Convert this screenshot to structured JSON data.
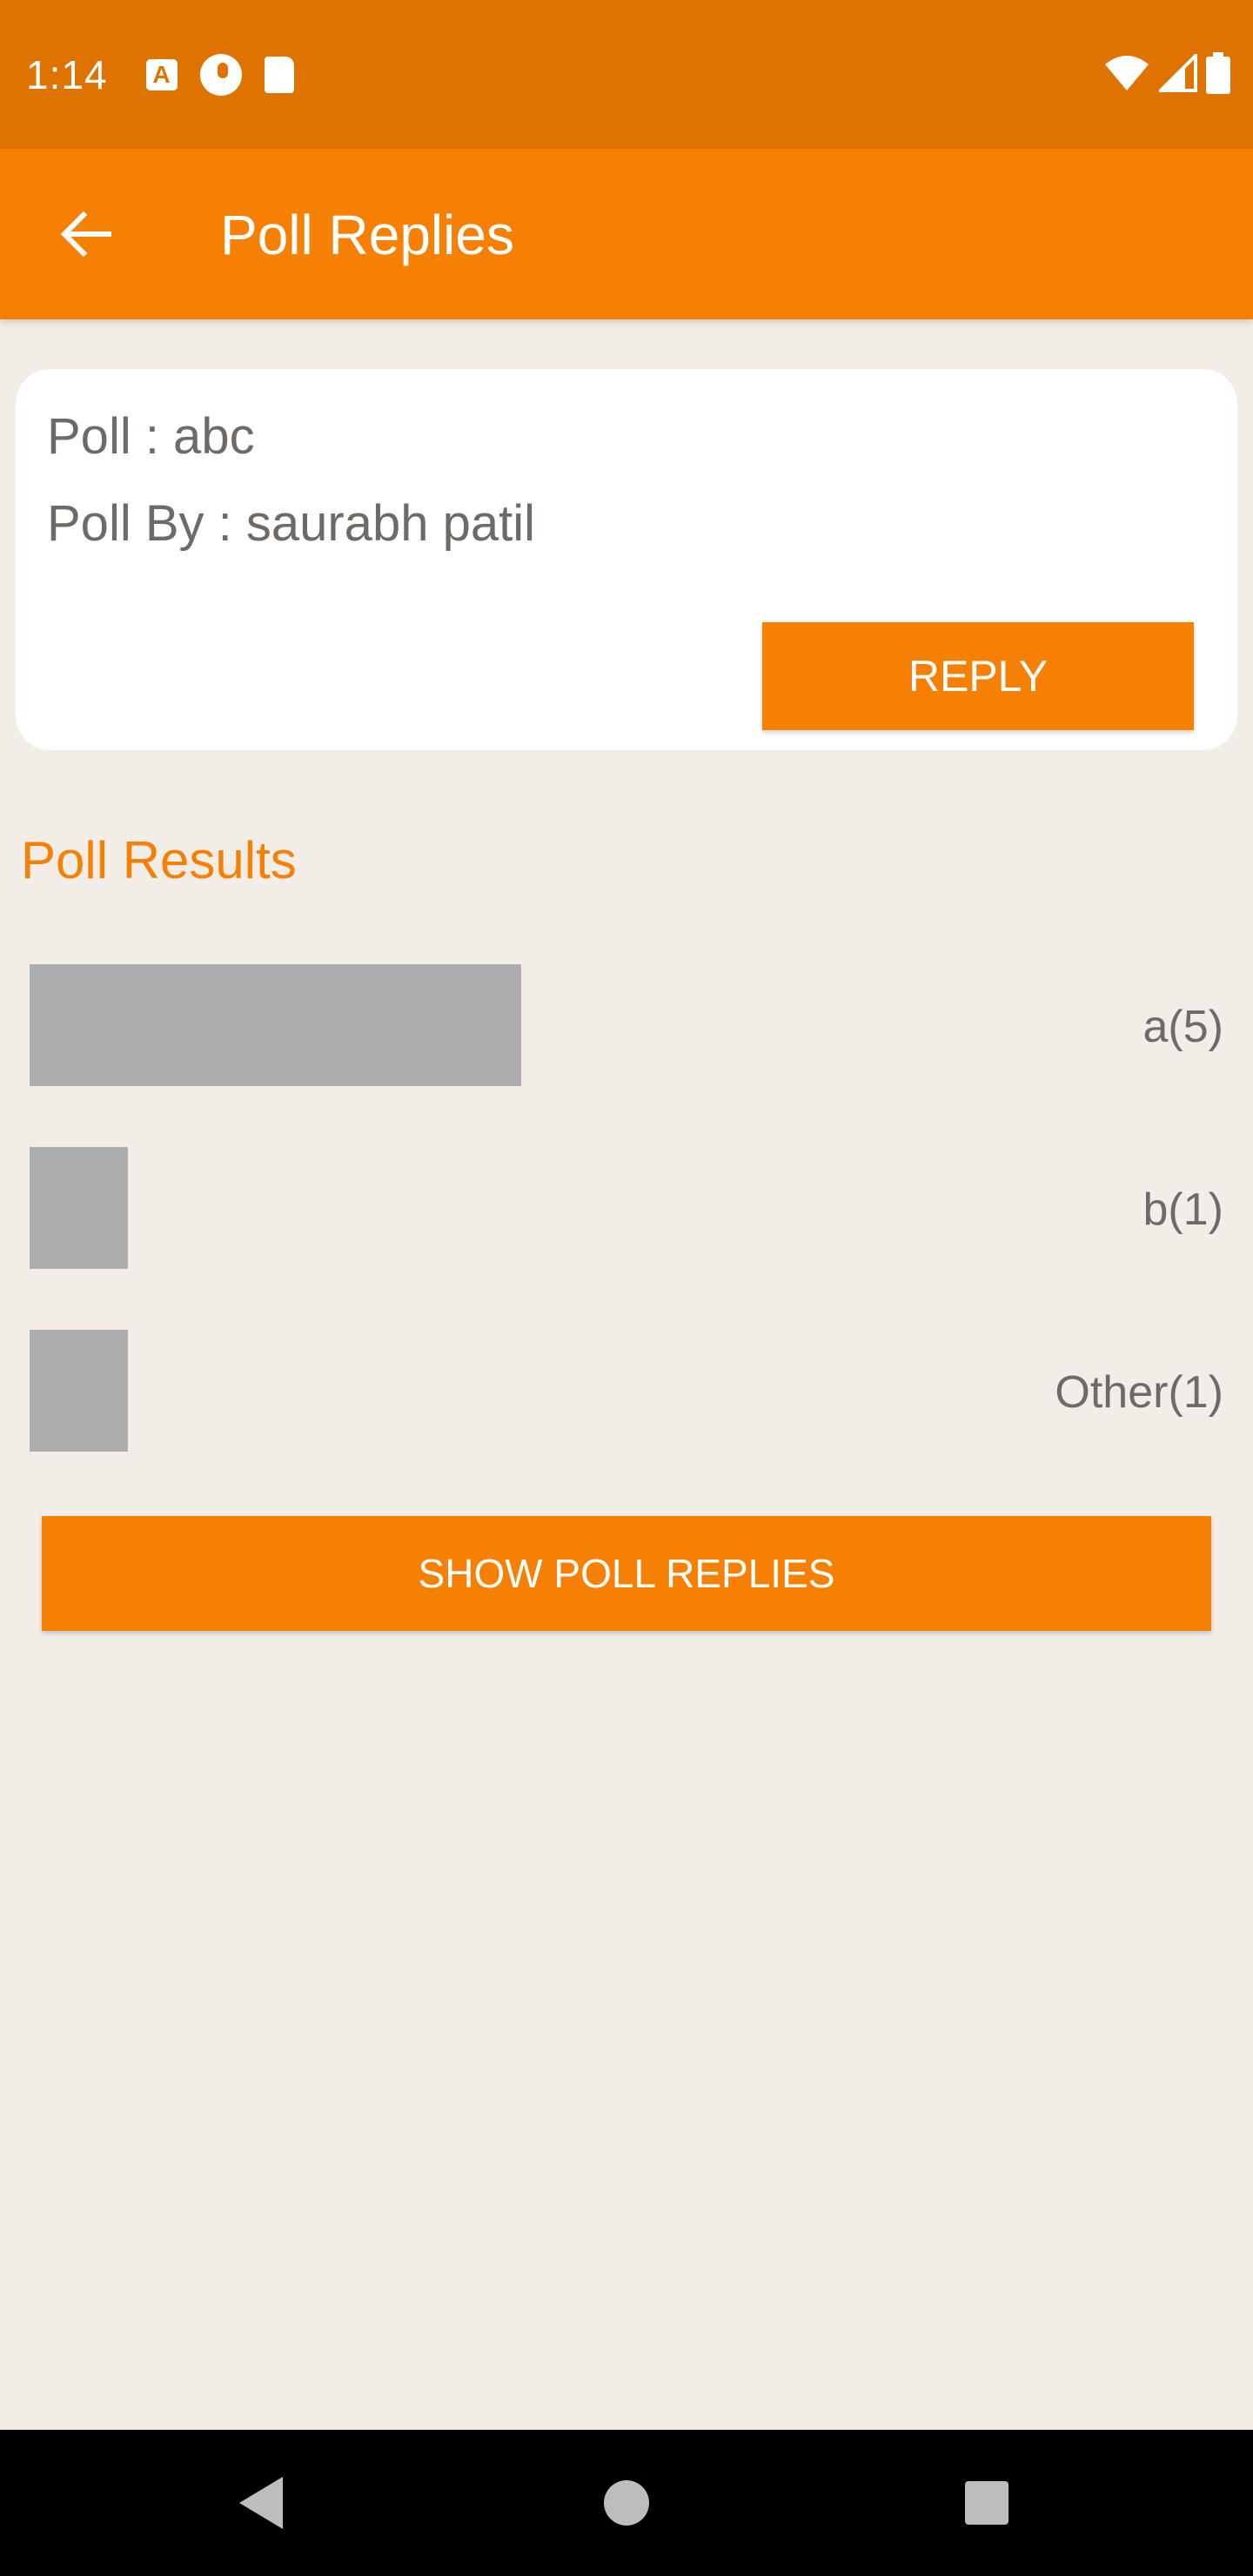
{
  "status_bar": {
    "time": "1:14",
    "icons": [
      "a-notification-icon",
      "circle-app-icon",
      "sd-card-icon",
      "wifi-icon",
      "signal-icon",
      "battery-icon"
    ]
  },
  "app_bar": {
    "title": "Poll Replies",
    "back_icon": "arrow-left-icon"
  },
  "poll": {
    "title_line": "Poll : abc",
    "by_line": "Poll By : saurabh patil",
    "reply_label": "REPLY"
  },
  "results": {
    "heading": "Poll Results",
    "options": [
      {
        "label": "a(5)",
        "count": 5
      },
      {
        "label": "b(1)",
        "count": 1
      },
      {
        "label": "Other(1)",
        "count": 1
      }
    ]
  },
  "show_replies_label": "SHOW POLL REPLIES",
  "colors": {
    "primary": "#f58003",
    "status_bar": "#df7300",
    "background": "#f3ede7",
    "bar": "#aeadad",
    "text": "#6f6a66"
  }
}
